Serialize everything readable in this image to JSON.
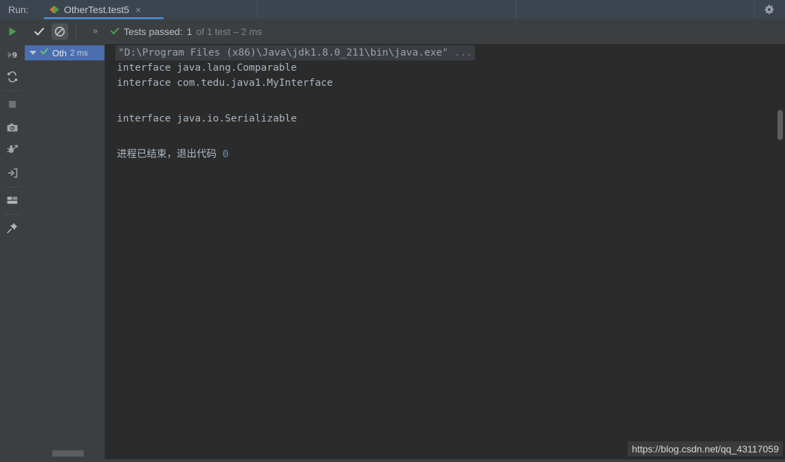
{
  "titlebar": {
    "run_label": "Run:",
    "tab": {
      "title": "OtherTest.test5",
      "close": "×",
      "icon": "junit-run-config-icon"
    },
    "settings_icon": "gear-icon"
  },
  "toolbar": {
    "show_passed_icon": "check-icon",
    "show_ignored_icon": "ignored-tests-icon",
    "expand_icon": "double-chevron-right-icon",
    "status": {
      "status_icon": "green-check-icon",
      "label": "Tests passed:",
      "count": "1",
      "detail": "of 1 test – 2 ms"
    }
  },
  "sidebar": {
    "items": [
      {
        "name": "rerun-button",
        "icon": "green-play-icon"
      },
      {
        "name": "rerun-failed-tests-button",
        "icon": "rerun-failed-icon"
      },
      {
        "name": "toggle-auto-test-button",
        "icon": "cyclic-rerun-icon"
      },
      {
        "name": "stop-button",
        "icon": "stop-square-icon"
      },
      {
        "name": "snapshot-button",
        "icon": "camera-icon"
      },
      {
        "name": "dump-threads-button",
        "icon": "bug-arrow-icon"
      },
      {
        "name": "import-tests-button",
        "icon": "import-arrow-icon"
      },
      {
        "name": "layout-settings-button",
        "icon": "layout-icon"
      },
      {
        "name": "pin-tab-button",
        "icon": "pin-icon"
      }
    ]
  },
  "tree": {
    "row": {
      "expander_icon": "triangle-down-icon",
      "status_icon": "green-check-icon",
      "label": "Oth",
      "duration": "2 ms"
    },
    "horizontal_scrollbar": "tree-hscrollbar"
  },
  "console": {
    "command_line": "\"D:\\Program Files (x86)\\Java\\jdk1.8.0_211\\bin\\java.exe\"",
    "command_ellipsis": " ...",
    "lines": [
      "interface java.lang.Comparable",
      "interface com.tedu.java1.MyInterface",
      "",
      "interface java.io.Serializable"
    ],
    "exit_text": "进程已结束，退出代码 ",
    "exit_code": "0",
    "watermark": "https://blog.csdn.net/qq_43117059"
  },
  "colors": {
    "titlebar_bg": "#3c4450",
    "panel_bg": "#3c3f41",
    "console_bg": "#2b2b2b",
    "selection_blue": "#4b6eaf",
    "tab_underline": "#4a88c7",
    "console_text": "#a9b7c6",
    "success_green": "#499c54",
    "exit_code_blue": "#6897bb"
  }
}
